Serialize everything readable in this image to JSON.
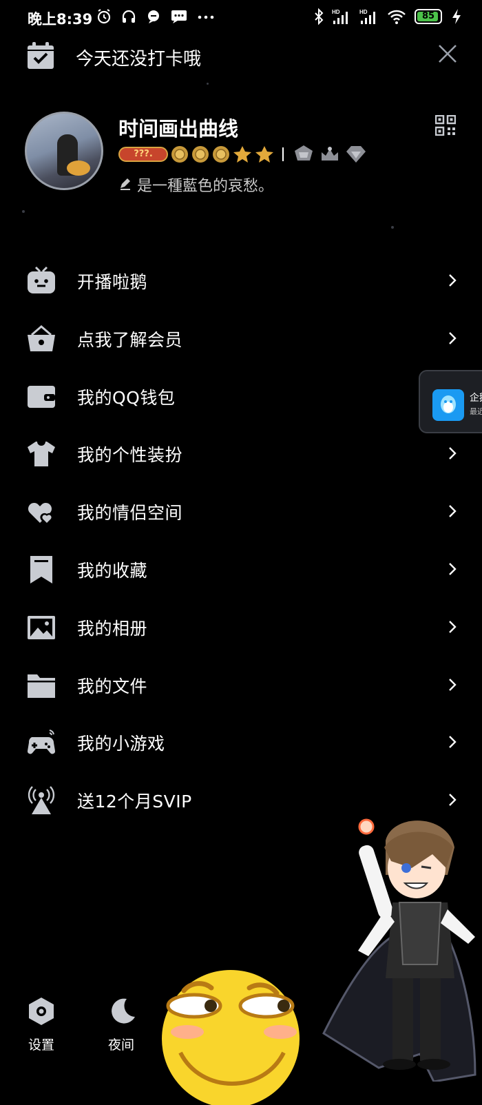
{
  "status_bar": {
    "time": "晚上8:39",
    "battery": "85",
    "left_icons": [
      "alarm-icon",
      "headphones-icon",
      "chat-bubble-icon",
      "message-icon",
      "more-dots-icon"
    ],
    "right_icons": [
      "bluetooth-icon",
      "signal-hd-icon",
      "signal-hd-icon",
      "wifi-icon",
      "battery-icon",
      "charging-icon"
    ]
  },
  "checkin": {
    "text": "今天还没打卡哦",
    "icon": "calendar-check-icon"
  },
  "profile": {
    "name": "时间画出曲线",
    "level_badge": "???.",
    "signature": "是一種藍色的哀愁。",
    "rank_icons": [
      "sun-icon",
      "sun-icon",
      "sun-icon",
      "star-icon",
      "star-icon"
    ],
    "medal_icons": [
      "crest-icon",
      "crown-icon",
      "diamond-icon"
    ]
  },
  "menu": [
    {
      "label": "开播啦鹅",
      "icon": "tv-icon"
    },
    {
      "label": "点我了解会员",
      "icon": "vip-basket-icon"
    },
    {
      "label": "我的QQ钱包",
      "icon": "wallet-icon"
    },
    {
      "label": "我的个性装扮",
      "icon": "shirt-icon"
    },
    {
      "label": "我的情侣空间",
      "icon": "hearts-icon"
    },
    {
      "label": "我的收藏",
      "icon": "bookmark-icon"
    },
    {
      "label": "我的相册",
      "icon": "photo-icon"
    },
    {
      "label": "我的文件",
      "icon": "folder-icon"
    },
    {
      "label": "我的小游戏",
      "icon": "gamepad-icon"
    },
    {
      "label": "送12个月SVIP",
      "icon": "broadcast-tower-icon"
    }
  ],
  "popup": {
    "title": "企鹅",
    "subtitle": "最近"
  },
  "bottom": {
    "settings": "设置",
    "night": "夜间"
  },
  "colors": {
    "background": "#000000",
    "icon_gray": "#c9ccd2",
    "battery_green": "#4cc24a"
  }
}
